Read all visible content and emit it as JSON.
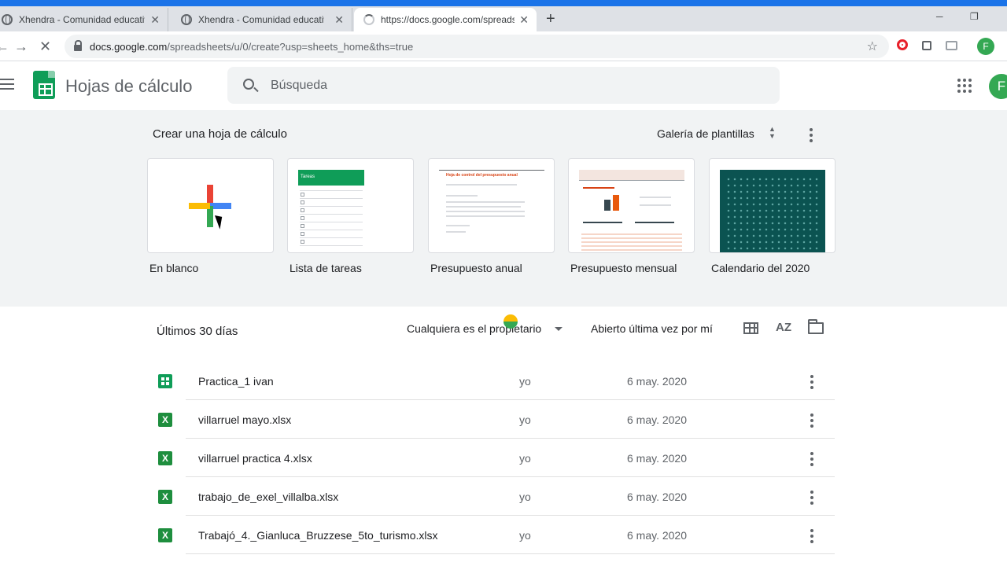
{
  "browser": {
    "tabs": [
      {
        "title": "Xhendra - Comunidad educativa",
        "close": "✕"
      },
      {
        "title": "Xhendra - Comunidad educativa",
        "close": "✕"
      },
      {
        "title": "https://docs.google.com/spreadsheets",
        "close": "✕"
      }
    ],
    "new_tab": "+",
    "url_host": "docs.google.com",
    "url_path": "/spreadsheets/u/0/create?usp=sheets_home&ths=true",
    "profile_initial": "F"
  },
  "header": {
    "app_title": "Hojas de cálculo",
    "search_placeholder": "Búsqueda",
    "avatar_initial": "F"
  },
  "templates": {
    "section_label": "Crear una hoja de cálculo",
    "gallery_label": "Galería de plantillas",
    "items": [
      {
        "label": "En blanco"
      },
      {
        "label": "Lista de tareas",
        "thumb_header": "Tareas"
      },
      {
        "label": "Presupuesto anual",
        "thumb_header": "Hoja de control del presupuesto anual"
      },
      {
        "label": "Presupuesto mensual"
      },
      {
        "label": "Calendario del 2020"
      }
    ]
  },
  "recent": {
    "title": "Últimos 30 días",
    "owner_filter": "Cualquiera es el propietario",
    "sort_label": "Abierto última vez por mí",
    "files": [
      {
        "name": "Practica_1 ivan",
        "owner": "yo",
        "date": "6 may. 2020",
        "type": "sheet"
      },
      {
        "name": "villarruel mayo.xlsx",
        "owner": "yo",
        "date": "6 may. 2020",
        "type": "xlsx"
      },
      {
        "name": "villarruel practica 4.xlsx",
        "owner": "yo",
        "date": "6 may. 2020",
        "type": "xlsx"
      },
      {
        "name": "trabajo_de_exel_villalba.xlsx",
        "owner": "yo",
        "date": "6 may. 2020",
        "type": "xlsx"
      },
      {
        "name": "Trabajó_4._Gianluca_Bruzzese_5to_turismo.xlsx",
        "owner": "yo",
        "date": "6 may. 2020",
        "type": "xlsx"
      }
    ],
    "xlsx_icon_letter": "X"
  },
  "colors": {
    "accent": "#1a73e8",
    "sheets_green": "#0f9d58",
    "excel_green": "#1e8e3e"
  }
}
